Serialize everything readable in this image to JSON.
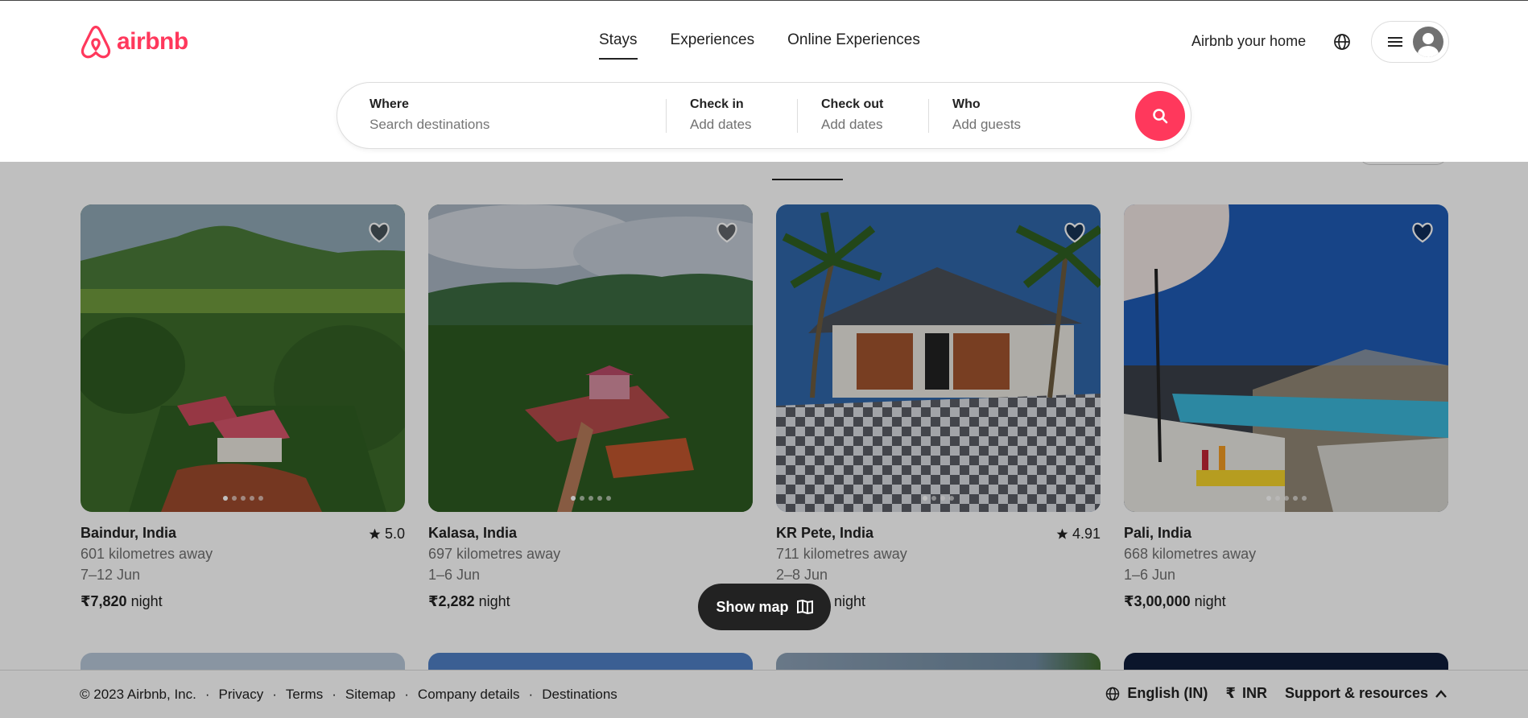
{
  "brand": {
    "name": "airbnb",
    "color": "#ff385c"
  },
  "nav": {
    "tabs": [
      {
        "label": "Stays",
        "active": true
      },
      {
        "label": "Experiences",
        "active": false
      },
      {
        "label": "Online Experiences",
        "active": false
      }
    ]
  },
  "header": {
    "host_link": "Airbnb your home",
    "globe_icon": "globe-icon",
    "menu_icon": "hamburger-icon",
    "avatar_icon": "user-avatar-icon"
  },
  "search": {
    "where": {
      "title": "Where",
      "placeholder": "Search destinations"
    },
    "checkin": {
      "title": "Check in",
      "value": "Add dates"
    },
    "checkout": {
      "title": "Check out",
      "value": "Add dates"
    },
    "who": {
      "title": "Who",
      "value": "Add guests"
    },
    "button_icon": "search-icon"
  },
  "listings": [
    {
      "location": "Baindur, India",
      "rating": "5.0",
      "distance": "601 kilometres away",
      "dates": "7–12 Jun",
      "price": "₹7,820",
      "unit": "night"
    },
    {
      "location": "Kalasa, India",
      "rating": "",
      "distance": "697 kilometres away",
      "dates": "1–6 Jun",
      "price": "₹2,282",
      "unit": "night"
    },
    {
      "location": "KR Pete, India",
      "rating": "4.91",
      "distance": "711 kilometres away",
      "dates": "2–8 Jun",
      "price": "",
      "unit": "night"
    },
    {
      "location": "Pali, India",
      "rating": "",
      "distance": "668 kilometres away",
      "dates": "1–6 Jun",
      "price": "₹3,00,000",
      "unit": "night"
    }
  ],
  "show_map": {
    "label": "Show map",
    "icon": "map-icon"
  },
  "footer": {
    "copyright": "© 2023 Airbnb, Inc.",
    "links": [
      "Privacy",
      "Terms",
      "Sitemap",
      "Company details",
      "Destinations"
    ],
    "language": "English (IN)",
    "currency_symbol": "₹",
    "currency": "INR",
    "support": "Support & resources"
  }
}
